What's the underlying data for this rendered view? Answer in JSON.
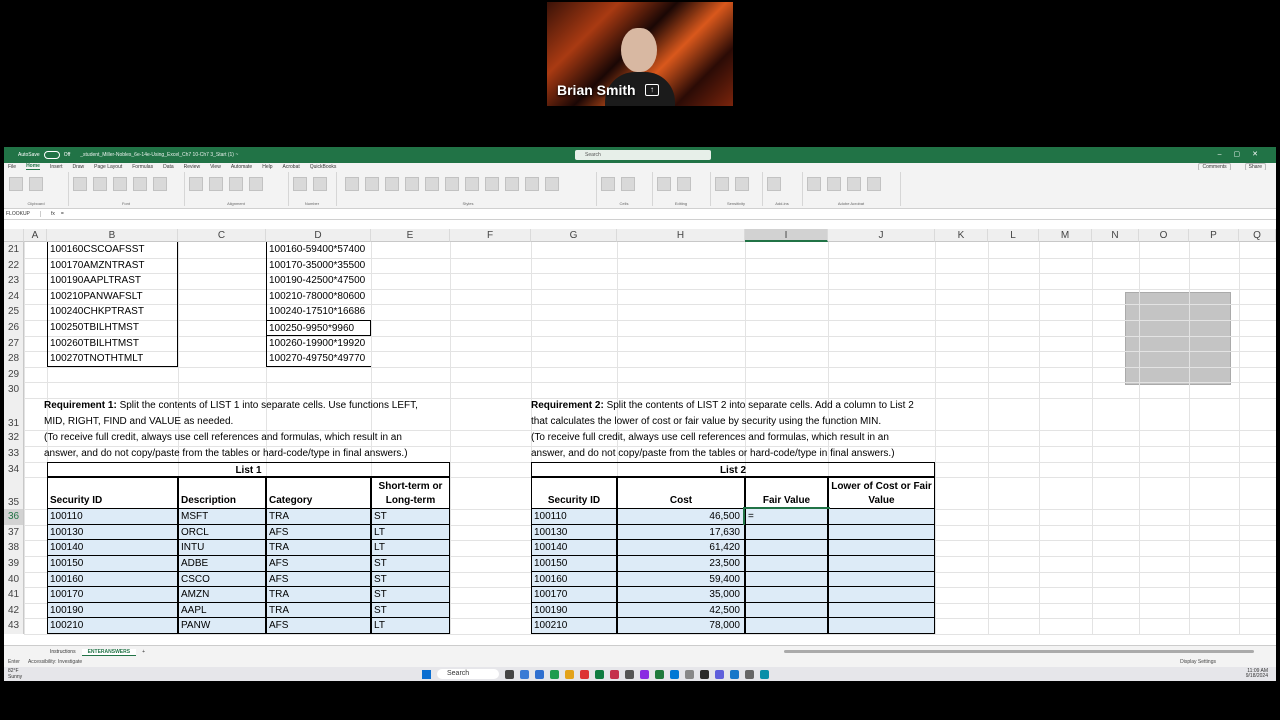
{
  "video": {
    "name": "Brian Smith"
  },
  "titlebar": {
    "autosave": "AutoSave",
    "toggle": "Off",
    "filename": "_student_Miller-Nobles_6e-14e-Using_Excel_Ch7 10-Ch7 3_Start (1) ~",
    "search_placeholder": "Search"
  },
  "menu": {
    "items": [
      "File",
      "Home",
      "Insert",
      "Draw",
      "Page Layout",
      "Formulas",
      "Data",
      "Review",
      "View",
      "Automate",
      "Help",
      "Acrobat",
      "QuickBooks"
    ],
    "active": "Home",
    "comments": "Comments",
    "share": "Share"
  },
  "ribbon": {
    "groups": [
      "Clipboard",
      "Font",
      "Alignment",
      "Number",
      "Styles",
      "Cells",
      "Editing",
      "Sensitivity",
      "Add-ins",
      "Adobe Acrobat"
    ]
  },
  "formula": {
    "namebox": "FLOOKUP",
    "fx": "fx",
    "content": "="
  },
  "columns": [
    "A",
    "B",
    "C",
    "D",
    "E",
    "F",
    "G",
    "H",
    "I",
    "J",
    "K",
    "L",
    "M",
    "N",
    "O",
    "P",
    "Q"
  ],
  "selected_column": "I",
  "selected_row": "36",
  "rows": [
    "21",
    "22",
    "23",
    "24",
    "25",
    "26",
    "27",
    "28",
    "29",
    "30",
    "31",
    "32",
    "33",
    "34",
    "35",
    "36",
    "37",
    "38",
    "39",
    "40",
    "41",
    "42",
    "43"
  ],
  "list_b": [
    "100160CSCOAFSST",
    "100170AMZNTRAST",
    "100190AAPLTRAST",
    "100210PANWAFSLT",
    "100240CHKPTRAST",
    "100250TBILHTMST",
    "100260TBILHTMST",
    "100270TNOTHTMLT"
  ],
  "list_d": [
    "100160-59400*57400",
    "100170-35000*35500",
    "100190-42500*47500",
    "100210-78000*80600",
    "100240-17510*16686",
    "100250-9950*9960",
    "100260-19900*19920",
    "100270-49750*49770"
  ],
  "req1": {
    "label": "Requirement 1:",
    "line1": "Split the contents of LIST 1 into separate cells. Use functions LEFT,",
    "line2": "MID, RIGHT, FIND and VALUE as needed.",
    "line3": "(To receive full credit, always use cell references and formulas, which result in an",
    "line4": "answer, and do not copy/paste from the tables or hard-code/type in final answers.)"
  },
  "req2": {
    "label": "Requirement 2:",
    "line1": "Split the contents of LIST 2 into separate cells. Add a column to List 2",
    "line2": "that calculates the lower of cost or fair value by security using the function MIN.",
    "line3": "(To receive full credit, always use cell references and formulas, which result in an",
    "line4": "answer, and do not copy/paste from the tables or hard-code/type in final answers.)"
  },
  "list1": {
    "title": "List 1",
    "headers": [
      "Security ID",
      "Description",
      "Category",
      "Short-term or Long-term"
    ],
    "rows": [
      [
        "100110",
        "MSFT",
        "TRA",
        "ST"
      ],
      [
        "100130",
        "ORCL",
        "AFS",
        "LT"
      ],
      [
        "100140",
        "INTU",
        "TRA",
        "LT"
      ],
      [
        "100150",
        "ADBE",
        "AFS",
        "ST"
      ],
      [
        "100160",
        "CSCO",
        "AFS",
        "ST"
      ],
      [
        "100170",
        "AMZN",
        "TRA",
        "ST"
      ],
      [
        "100190",
        "AAPL",
        "TRA",
        "ST"
      ],
      [
        "100210",
        "PANW",
        "AFS",
        "LT"
      ]
    ]
  },
  "list2": {
    "title": "List 2",
    "headers": [
      "Security ID",
      "Cost",
      "Fair Value",
      "Lower of Cost or Fair Value"
    ],
    "rows": [
      [
        "100110",
        "46,500",
        "=",
        ""
      ],
      [
        "100130",
        "17,630",
        "",
        ""
      ],
      [
        "100140",
        "61,420",
        "",
        ""
      ],
      [
        "100150",
        "23,500",
        "",
        ""
      ],
      [
        "100160",
        "59,400",
        "",
        ""
      ],
      [
        "100170",
        "35,000",
        "",
        ""
      ],
      [
        "100190",
        "42,500",
        "",
        ""
      ],
      [
        "100210",
        "78,000",
        "",
        ""
      ]
    ]
  },
  "sheets": [
    "Instructions",
    "ENTERANSWERS"
  ],
  "active_sheet": "ENTERANSWERS",
  "status": {
    "left": "Enter",
    "accessibility": "Accessibility: Investigate",
    "display": "Display Settings"
  },
  "taskbar": {
    "weather_temp": "82°F",
    "weather_desc": "Sunny",
    "search": "Search",
    "time": "11:09 AM",
    "date": "9/18/2024"
  }
}
